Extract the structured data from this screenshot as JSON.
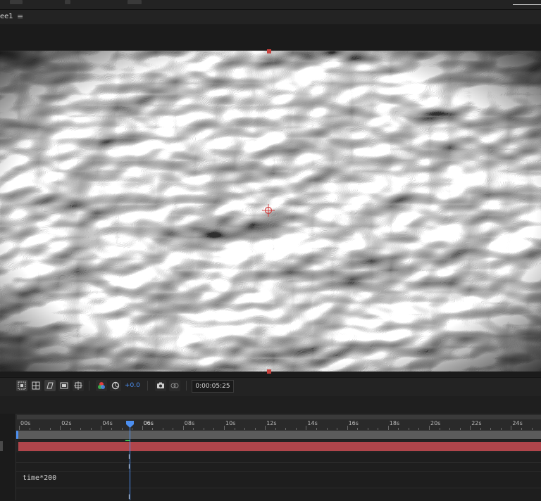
{
  "panel": {
    "tab_label": "ee1",
    "menu_glyph": "≡"
  },
  "viewer_toolbar": {
    "exposure_value": "+0.0",
    "timecode": "0:00:05:25",
    "icons": [
      "region-of-interest-icon",
      "transparency-grid-icon",
      "mask-path-icon",
      "safe-margins-icon",
      "snapshot-grid-icon",
      "color-channels-icon",
      "reset-exposure-icon",
      "snapshot-icon",
      "show-snapshot-icon"
    ]
  },
  "timeline": {
    "ruler_labels": [
      "00s",
      "02s",
      "04s",
      "06s",
      "08s",
      "10s",
      "12s",
      "14s",
      "16s",
      "18s",
      "20s",
      "22s",
      "24s"
    ],
    "current_time_label": "06s",
    "expression": "time*200",
    "keyframe_glyph": "I"
  },
  "colors": {
    "accent_blue": "#4c8ff0",
    "layer_bar": "#b0454b",
    "handle_red": "#c8413d"
  }
}
